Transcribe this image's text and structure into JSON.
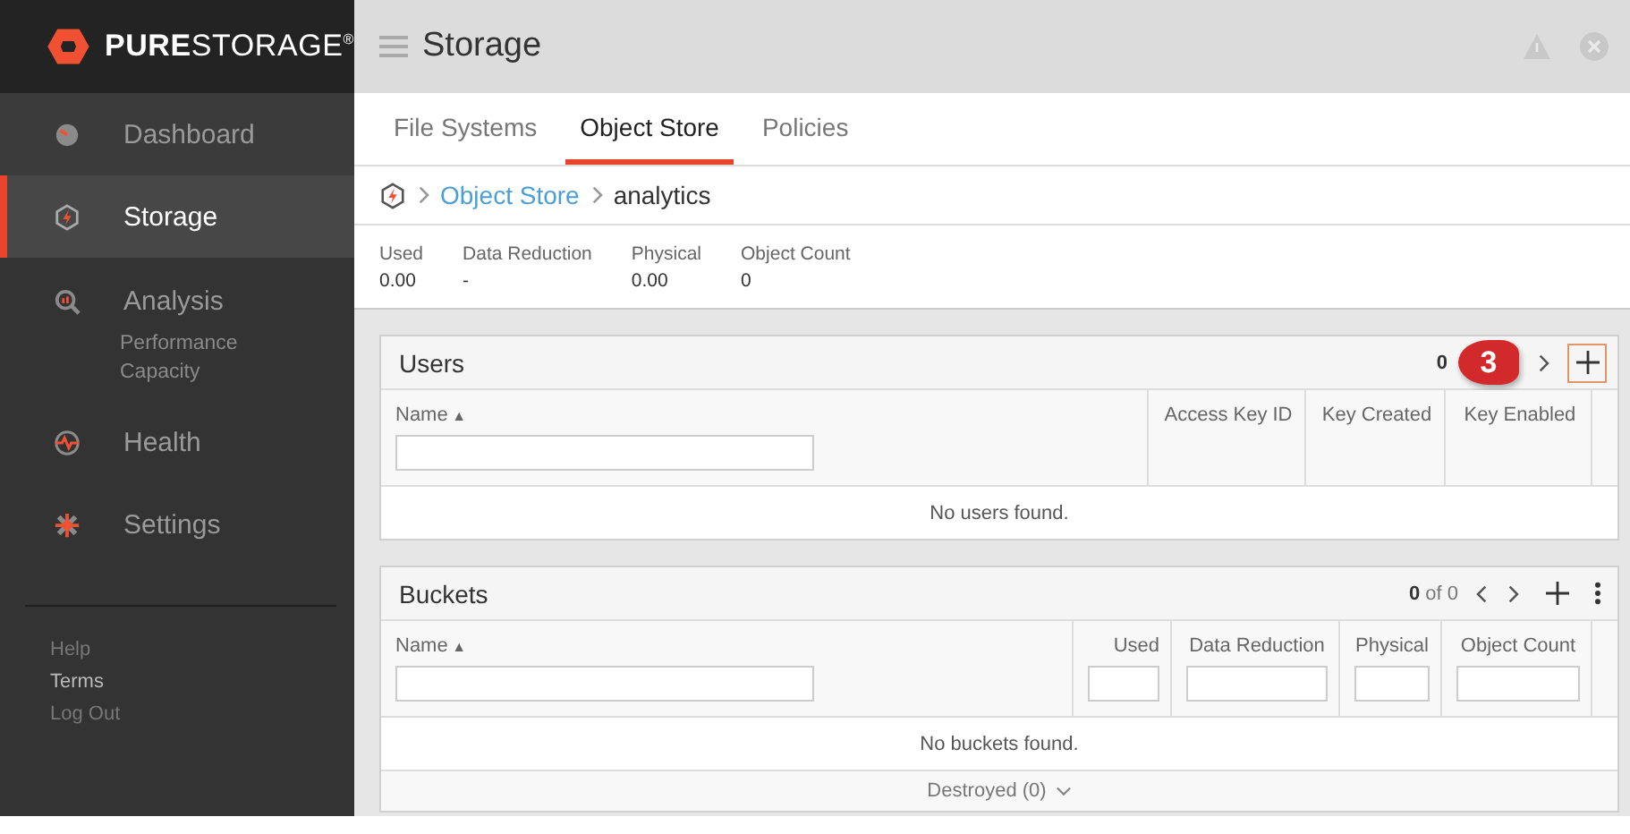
{
  "brand": {
    "name": "**PURE**STORAGE$^{®}$"
  },
  "sidebar": {
    "items": [
      {
        "label": "Dashboard",
        "selected": false
      },
      {
        "label": "Storage",
        "selected": true
      },
      {
        "label": "Analysis",
        "selected": false,
        "children": [
          {
            "label": "Performance"
          },
          {
            "label": "Capacity"
          }
        ]
      },
      {
        "label": "Health",
        "selected": false
      },
      {
        "label": "Settings",
        "selected": false
      }
    ],
    "links": [
      {
        "label": "Help",
        "selected": false
      },
      {
        "label": "Terms",
        "selected": true
      },
      {
        "label": "Log Out",
        "selected": false
      }
    ]
  },
  "header": {
    "title": "Storage"
  },
  "tabs": [
    {
      "label": "File Systems",
      "selected": false
    },
    {
      "label": "Object Store",
      "selected": true
    },
    {
      "label": "Policies",
      "selected": false
    }
  ],
  "breadcrumb": [
    {
      "label": "Object Store",
      "link": true
    },
    {
      "label": "analytics",
      "link": false
    }
  ],
  "stats": [
    {
      "label": "Used",
      "value": "0.00"
    },
    {
      "label": "Data Reduction",
      "value": "-"
    },
    {
      "label": "Physical",
      "value": "0.00"
    },
    {
      "label": "Object Count",
      "value": "0"
    }
  ],
  "panels": [
    {
      "title": "Users",
      "count": "**0**",
      "prev": false,
      "next": true,
      "add_highlighted": true,
      "menu": false,
      "callout": "3",
      "columns": [
        {
          "label": "Name",
          "sort": "▲",
          "filter": true
        },
        {
          "label": "Access Key ID",
          "filter": false
        },
        {
          "label": "Key Created",
          "filter": false
        },
        {
          "label": "Key Enabled",
          "filter": false
        }
      ],
      "empty": "No users found."
    },
    {
      "title": "Buckets",
      "count": "**0** of 0",
      "prev": true,
      "next": true,
      "add_highlighted": false,
      "menu": true,
      "columns": [
        {
          "label": "Name",
          "sort": "▲",
          "filter": true
        },
        {
          "label": "Used",
          "filter": true
        },
        {
          "label": "Data Reduction",
          "filter": true
        },
        {
          "label": "Physical",
          "filter": true
        },
        {
          "label": "Object Count",
          "filter": true
        }
      ],
      "empty": "No buckets found.",
      "footer": "Destroyed (0)"
    }
  ]
}
